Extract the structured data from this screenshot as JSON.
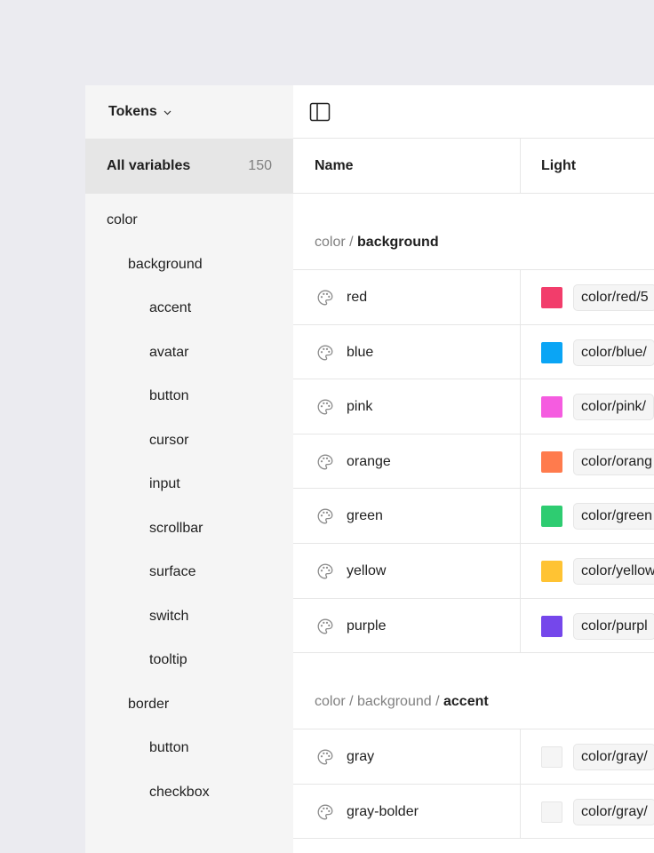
{
  "sidebar": {
    "title": "Tokens",
    "all_variables": {
      "label": "All variables",
      "count": "150"
    },
    "tree": [
      {
        "label": "color",
        "level": 0
      },
      {
        "label": "background",
        "level": 1
      },
      {
        "label": "accent",
        "level": 2
      },
      {
        "label": "avatar",
        "level": 2
      },
      {
        "label": "button",
        "level": 2
      },
      {
        "label": "cursor",
        "level": 2
      },
      {
        "label": "input",
        "level": 2
      },
      {
        "label": "scrollbar",
        "level": 2
      },
      {
        "label": "surface",
        "level": 2
      },
      {
        "label": "switch",
        "level": 2
      },
      {
        "label": "tooltip",
        "level": 2
      },
      {
        "label": "border",
        "level": 1
      },
      {
        "label": "button",
        "level": 2
      },
      {
        "label": "checkbox",
        "level": 2
      }
    ]
  },
  "table": {
    "columns": {
      "name": "Name",
      "light": "Light"
    },
    "groups": [
      {
        "path": [
          "color",
          "background"
        ],
        "rows": [
          {
            "name": "red",
            "swatch": "#f23d6b",
            "value": "color/red/5"
          },
          {
            "name": "blue",
            "swatch": "#0aa5f5",
            "value": "color/blue/"
          },
          {
            "name": "pink",
            "swatch": "#f55ce0",
            "value": "color/pink/"
          },
          {
            "name": "orange",
            "swatch": "#ff7b4d",
            "value": "color/orang"
          },
          {
            "name": "green",
            "swatch": "#2ecc71",
            "value": "color/green"
          },
          {
            "name": "yellow",
            "swatch": "#ffc333",
            "value": "color/yellow"
          },
          {
            "name": "purple",
            "swatch": "#7547eb",
            "value": "color/purpl"
          }
        ]
      },
      {
        "path": [
          "color",
          "background",
          "accent"
        ],
        "rows": [
          {
            "name": "gray",
            "swatch": "#f5f5f5",
            "value": "color/gray/"
          },
          {
            "name": "gray-bolder",
            "swatch": "#f5f5f5",
            "value": "color/gray/"
          }
        ]
      }
    ]
  },
  "icons": {
    "dropdown": "chevron-down-icon",
    "toggle_panel": "sidebar-panel-icon",
    "token": "palette-icon"
  }
}
